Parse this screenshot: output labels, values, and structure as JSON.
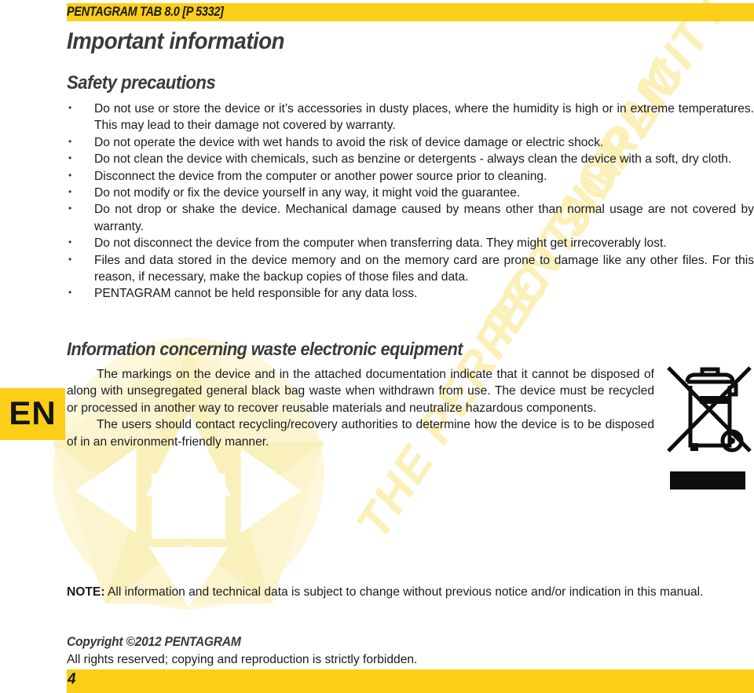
{
  "header": {
    "banner_title": "PENTAGRAM TAB 8.0 [P 5332]",
    "banner_color": "#FBCE17"
  },
  "titles": {
    "doc_title": "Important information",
    "safety_heading": "Safety precautions",
    "weee_heading": "Information concerning waste electronic equipment"
  },
  "safety_bullets": [
    "Do not use or store the device or it’s accessories in dusty places, where the humidity is high or in extreme temperatures. This may lead to their damage not covered by warranty.",
    "Do not operate the device with wet hands to avoid the risk of device damage or electric shock.",
    "Do not clean the device with chemicals, such as benzine or detergents - always clean the device with a soft, dry cloth.",
    "Disconnect the device from the computer or another power source prior to cleaning.",
    "Do not modify or fix the device yourself in any way, it might void the guarantee.",
    "Do not drop or shake the device. Mechanical damage caused by means other than normal usage are not covered by warranty.",
    "Do not disconnect the device from the computer when transferring data. They might get irrecoverably lost.",
    "Files and data stored in the device memory and on the memory card are prone to damage like any other files. For this reason, if necessary, make the backup copies of those files and data.",
    "PENTAGRAM cannot be held responsible for any data loss."
  ],
  "weee_paragraphs": [
    "The markings on the device and in the attached documentation indicate that it cannot be disposed of along with unsegregated general black bag waste when withdrawn from use. The device must be recycled or processed in another way to recover reusable materials and neutralize hazardous components.",
    "The users should contact recycling/recovery authorities to determine how the device is to be disposed of in an environment-friendly manner."
  ],
  "language_badge": {
    "label": "EN",
    "background": "#FBCE17"
  },
  "note": {
    "label": "NOTE:",
    "text": " All information and technical data is subject to change without previous notice and/or indication in this manual."
  },
  "copyright": {
    "line1": "Copyright ©2012 PENTAGRAM",
    "line2": "All rights reserved; copying and reproduction is strictly forbidden."
  },
  "footer": {
    "page_number": "4",
    "banner_color": "#FBCE17"
  },
  "watermark": {
    "text_top": "PENTAGRAM",
    "text_bottom": "THE PERFECT SIMPLICITY",
    "color": "#FBF0B8"
  },
  "weee_symbol": {
    "name": "crossed-out-wheelie-bin",
    "bar_color": "#0D0D0D"
  }
}
